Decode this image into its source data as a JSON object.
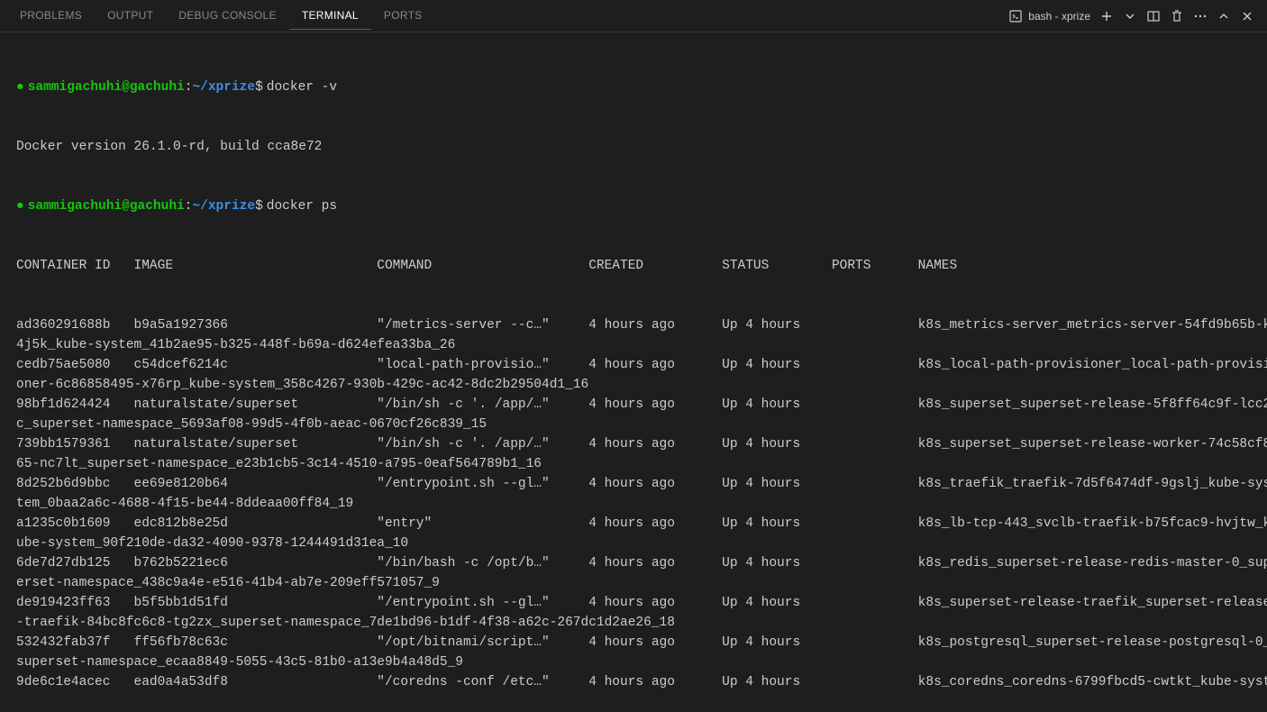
{
  "tabs": {
    "problems": "PROBLEMS",
    "output": "OUTPUT",
    "debugConsole": "DEBUG CONSOLE",
    "terminal": "TERMINAL",
    "ports": "PORTS"
  },
  "titlebar": {
    "shell": "bash - xprize"
  },
  "prompt": {
    "user": "sammigachuhi@gachuhi",
    "path": "~/xprize",
    "dollar": "$"
  },
  "commands": {
    "dockerVersion": "docker -v",
    "dockerPs": "docker ps"
  },
  "versionOutput": "Docker version 26.1.0-rd, build cca8e72",
  "psHeader": {
    "containerId": "CONTAINER ID",
    "image": "IMAGE",
    "command": "COMMAND",
    "created": "CREATED",
    "status": "STATUS",
    "ports": "PORTS",
    "names": "NAMES"
  },
  "rows": [
    {
      "id": "ad360291688b",
      "image": "b9a5a1927366",
      "command": "\"/metrics-server --c…\"",
      "created": "4 hours ago",
      "status": "Up 4 hours",
      "names": "k8s_metrics-server_metrics-server-54fd9b65b-k"
    },
    {
      "wrap": "4j5k_kube-system_41b2ae95-b325-448f-b69a-d624efea33ba_26"
    },
    {
      "id": "cedb75ae5080",
      "image": "c54dcef6214c",
      "command": "\"local-path-provisio…\"",
      "created": "4 hours ago",
      "status": "Up 4 hours",
      "names": "k8s_local-path-provisioner_local-path-provisi"
    },
    {
      "wrap": "oner-6c86858495-x76rp_kube-system_358c4267-930b-429c-ac42-8dc2b29504d1_16"
    },
    {
      "id": "98bf1d624424",
      "image": "naturalstate/superset",
      "command": "\"/bin/sh -c '. /app/…\"",
      "created": "4 hours ago",
      "status": "Up 4 hours",
      "names": "k8s_superset_superset-release-5f8ff64c9f-lcc2"
    },
    {
      "wrap": "c_superset-namespace_5693af08-99d5-4f0b-aeac-0670cf26c839_15"
    },
    {
      "id": "739bb1579361",
      "image": "naturalstate/superset",
      "command": "\"/bin/sh -c '. /app/…\"",
      "created": "4 hours ago",
      "status": "Up 4 hours",
      "names": "k8s_superset_superset-release-worker-74c58cf8"
    },
    {
      "wrap": "65-nc7lt_superset-namespace_e23b1cb5-3c14-4510-a795-0eaf564789b1_16"
    },
    {
      "id": "8d252b6d9bbc",
      "image": "ee69e8120b64",
      "command": "\"/entrypoint.sh --gl…\"",
      "created": "4 hours ago",
      "status": "Up 4 hours",
      "names": "k8s_traefik_traefik-7d5f6474df-9gslj_kube-sys"
    },
    {
      "wrap": "tem_0baa2a6c-4688-4f15-be44-8ddeaa00ff84_19"
    },
    {
      "id": "a1235c0b1609",
      "image": "edc812b8e25d",
      "command": "\"entry\"",
      "created": "4 hours ago",
      "status": "Up 4 hours",
      "names": "k8s_lb-tcp-443_svclb-traefik-b75fcac9-hvjtw_k"
    },
    {
      "wrap": "ube-system_90f210de-da32-4090-9378-1244491d31ea_10"
    },
    {
      "id": "6de7d27db125",
      "image": "b762b5221ec6",
      "command": "\"/bin/bash -c /opt/b…\"",
      "created": "4 hours ago",
      "status": "Up 4 hours",
      "names": "k8s_redis_superset-release-redis-master-0_sup"
    },
    {
      "wrap": "erset-namespace_438c9a4e-e516-41b4-ab7e-209eff571057_9"
    },
    {
      "id": "de919423ff63",
      "image": "b5f5bb1d51fd",
      "command": "\"/entrypoint.sh --gl…\"",
      "created": "4 hours ago",
      "status": "Up 4 hours",
      "names": "k8s_superset-release-traefik_superset-release"
    },
    {
      "wrap": "-traefik-84bc8fc6c8-tg2zx_superset-namespace_7de1bd96-b1df-4f38-a62c-267dc1d2ae26_18"
    },
    {
      "id": "532432fab37f",
      "image": "ff56fb78c63c",
      "command": "\"/opt/bitnami/script…\"",
      "created": "4 hours ago",
      "status": "Up 4 hours",
      "names": "k8s_postgresql_superset-release-postgresql-0_"
    },
    {
      "wrap": "superset-namespace_ecaa8849-5055-43c5-81b0-a13e9b4a48d5_9"
    },
    {
      "id": "9de6c1e4acec",
      "image": "ead0a4a53df8",
      "command": "\"/coredns -conf /etc…\"",
      "created": "4 hours ago",
      "status": "Up 4 hours",
      "names": "k8s_coredns_coredns-6799fbcd5-cwtkt_kube-syst"
    }
  ]
}
